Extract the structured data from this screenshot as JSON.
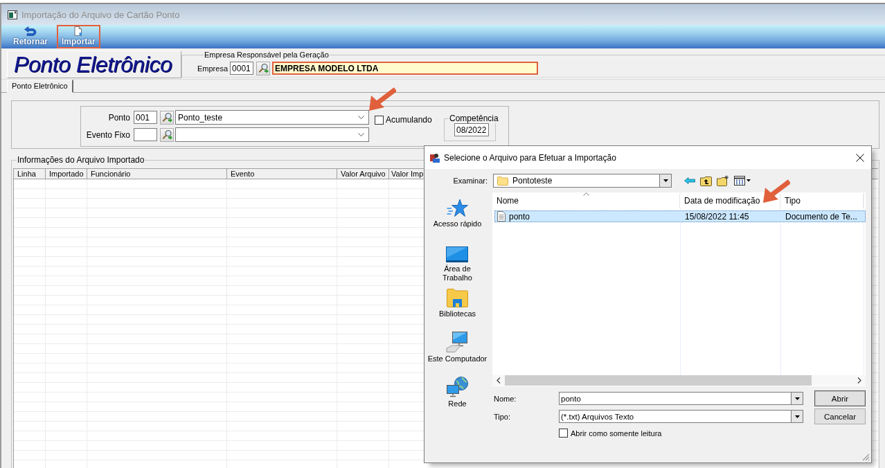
{
  "window": {
    "title": "Importação do Arquivo de Cartão Ponto"
  },
  "toolbar": {
    "buttons": [
      {
        "label": "Retornar",
        "kind": "return",
        "highlighted": false
      },
      {
        "label": "Importar",
        "kind": "import",
        "highlighted": true
      }
    ]
  },
  "header": {
    "logo": "Ponto Eletrônico",
    "group_title": "Empresa Responsável pela Geração",
    "empresa": {
      "label": "Empresa",
      "code": "0001",
      "name": "EMPRESA MODELO LTDA",
      "highlighted": true
    }
  },
  "tabs": [
    {
      "label": "Ponto Eletrônico",
      "selected": true
    }
  ],
  "filters": {
    "ponto": {
      "label": "Ponto",
      "code": "001",
      "value": "Ponto_teste"
    },
    "evento_fixo": {
      "label": "Evento Fixo"
    },
    "acumulando": {
      "label": "Acumulando",
      "checked": false
    },
    "competencia": {
      "label": "Competência",
      "value": "08/2022"
    }
  },
  "imported": {
    "title": "Informações do Arquivo Importado",
    "columns": [
      "Linha",
      "Importado",
      "Funcionário",
      "Evento",
      "Valor Arquivo",
      "Valor Imp"
    ]
  },
  "dialog": {
    "title": "Selecione o Arquivo para Efetuar a Importação",
    "look_in": {
      "label": "Examinar:",
      "value": "Pontoteste"
    },
    "places": [
      {
        "label": "Acesso rápido",
        "kind": "star"
      },
      {
        "label": "Área de\nTrabalho",
        "kind": "desktop"
      },
      {
        "label": "Bibliotecas",
        "kind": "libraries"
      },
      {
        "label": "Este Computador",
        "kind": "computer"
      },
      {
        "label": "Rede",
        "kind": "network"
      }
    ],
    "files": {
      "columns": [
        {
          "label": "Nome",
          "sorted": true
        },
        {
          "label": "Data de modificação",
          "sorted": false
        },
        {
          "label": "Tipo",
          "sorted": false
        }
      ],
      "rows": [
        {
          "cells": [
            "ponto",
            "15/08/2022 11:45",
            "Documento de Te..."
          ],
          "selected": true
        }
      ]
    },
    "file_name": {
      "label": "Nome:",
      "value": "ponto"
    },
    "file_type": {
      "label": "Tipo:",
      "value": "(*.txt) Arquivos Texto"
    },
    "read_only": {
      "label": "Abrir como somente leitura",
      "checked": false
    },
    "buttons": [
      "Abrir",
      "Cancelar"
    ]
  }
}
